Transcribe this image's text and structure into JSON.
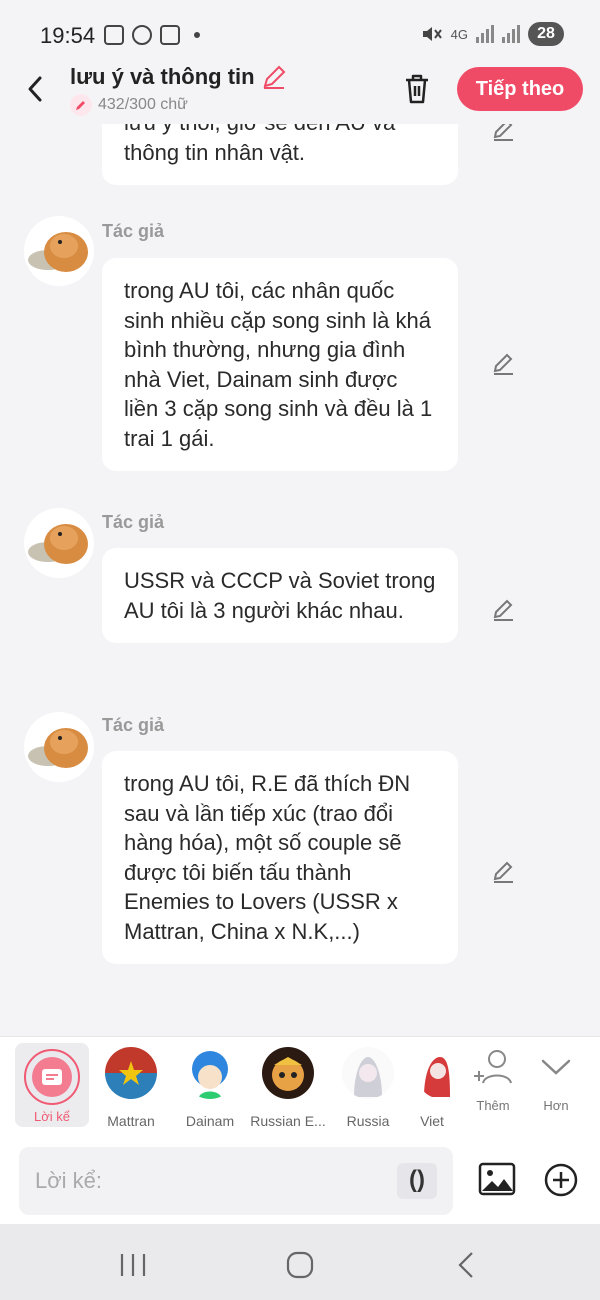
{
  "status_bar": {
    "time": "19:54",
    "network": "4G",
    "battery": "28"
  },
  "header": {
    "title": "lưu ý và thông tin",
    "char_count": "432/300 chữ",
    "next_label": "Tiếp theo"
  },
  "messages": [
    {
      "author": "",
      "text": "lưu ý thôi, giờ sẽ đến AU và thông tin nhân vật."
    },
    {
      "author": "Tác giả",
      "text": "trong AU tôi, các nhân quốc sinh nhiều cặp song sinh là khá bình thường, nhưng gia đình nhà Viet, Dainam sinh được liền 3 cặp song sinh và đều là 1 trai 1 gái."
    },
    {
      "author": "Tác giả",
      "text": "USSR và CCCP và Soviet trong AU tôi là 3 người khác nhau."
    },
    {
      "author": "Tác giả",
      "text": "trong AU tôi, R.E đã thích ĐN sau và lần tiếp xúc (trao đổi hàng hóa), một số couple sẽ được tôi biến tấu thành Enemies to Lovers (USSR x Mattran, China x N.K,...)"
    }
  ],
  "characters": {
    "narrator": "Lời kể",
    "list": [
      {
        "name": "Mattran"
      },
      {
        "name": "Dainam"
      },
      {
        "name": "Russian E..."
      },
      {
        "name": "Russia"
      },
      {
        "name": "Viet"
      }
    ],
    "add_label": "Thêm",
    "more_label": "Hơn"
  },
  "composer": {
    "placeholder": "Lời kể:",
    "paren_label": "()"
  }
}
